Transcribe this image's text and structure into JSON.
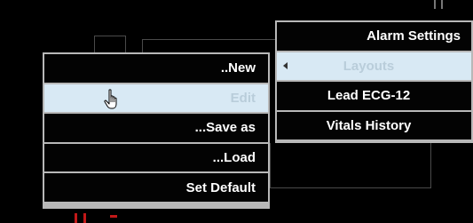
{
  "left_menu": {
    "items": [
      {
        "label": "..New",
        "state": "normal"
      },
      {
        "label": "Edit",
        "state": "highlighted"
      },
      {
        "label": "...Save as",
        "state": "normal"
      },
      {
        "label": "...Load",
        "state": "normal"
      },
      {
        "label": "Set Default",
        "state": "normal"
      }
    ]
  },
  "right_menu": {
    "items": [
      {
        "label": "Alarm Settings",
        "state": "normal"
      },
      {
        "label": "Layouts",
        "state": "highlighted",
        "has_submenu": true
      },
      {
        "label": "Lead ECG-12",
        "state": "normal"
      },
      {
        "label": "Vitals History",
        "state": "normal"
      }
    ]
  },
  "colors": {
    "menu_border": "#b8b8b8",
    "item_background": "#030303",
    "item_text": "#ffffff",
    "highlight_background": "#d8e9f4",
    "highlight_text": "#b9cdda"
  },
  "icons": {
    "cursor": "hand-pointer-icon",
    "submenu": "chevron-left-icon"
  }
}
